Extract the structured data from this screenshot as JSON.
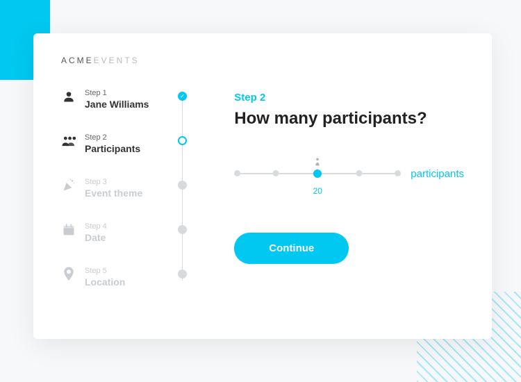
{
  "brand": {
    "part1": "ACME",
    "part2": "EVENTS"
  },
  "steps": [
    {
      "label": "Step 1",
      "title": "Jane Williams",
      "state": "done",
      "icon": "person"
    },
    {
      "label": "Step 2",
      "title": "Participants",
      "state": "current",
      "icon": "people"
    },
    {
      "label": "Step 3",
      "title": "Event theme",
      "state": "future",
      "icon": "party"
    },
    {
      "label": "Step 4",
      "title": "Date",
      "state": "future",
      "icon": "calendar"
    },
    {
      "label": "Step 5",
      "title": "Location",
      "state": "future",
      "icon": "pin"
    }
  ],
  "content": {
    "step_label": "Step 2",
    "heading": "How many participants?",
    "slider": {
      "value": 20,
      "unit": "participants"
    },
    "continue_label": "Continue"
  },
  "colors": {
    "accent": "#00c8f0",
    "muted": "#c9cdd1"
  }
}
